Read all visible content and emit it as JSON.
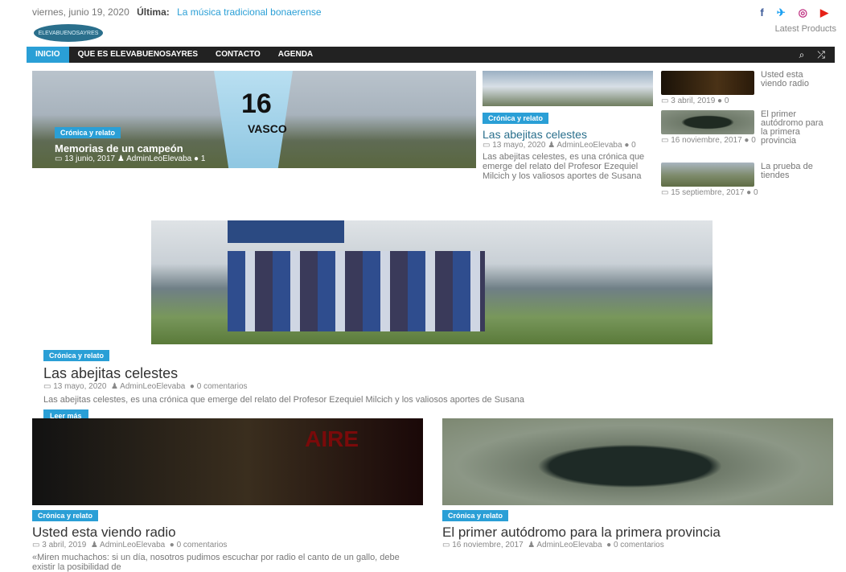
{
  "topbar": {
    "date": "viernes, junio 19, 2020",
    "ultima_label": "Última:",
    "ultima_text": "La música tradicional bonaerense",
    "latest_products": "Latest Products"
  },
  "nav": {
    "items": [
      "INICIO",
      "QUE ES ELEVABUENOSAYRES",
      "CONTACTO",
      "AGENDA"
    ],
    "search_icon": "search-icon",
    "random_icon": "shuffle-icon"
  },
  "lede": {
    "badge": "Crónica y relato",
    "title": "Memorias de un campeón",
    "date": "13 junio, 2017",
    "author": "AdminLeoElevaba",
    "comments": "1",
    "sign_number": "16",
    "sign_text": "VASCO"
  },
  "mid": {
    "badge": "Crónica y relato",
    "title": "Las abejitas celestes",
    "date": "13 mayo, 2020",
    "author": "AdminLeoElevaba",
    "comments": "0",
    "excerpt": "Las abejitas celestes, es una crónica que emerge del relato del Profesor Ezequiel Milcich y los valiosos aportes de Susana"
  },
  "side": [
    {
      "title": "Usted esta viendo radio",
      "date": "3 abril, 2019",
      "comments": "0"
    },
    {
      "title": "El primer autódromo para la primera provincia",
      "date": "16 noviembre, 2017",
      "comments": "0"
    },
    {
      "title": "La prueba de tiendes",
      "date": "15 septiembre, 2017",
      "comments": "0"
    }
  ],
  "big": {
    "badge": "Crónica y relato",
    "title": "Las abejitas celestes",
    "date": "13 mayo, 2020",
    "author": "AdminLeoElevaba",
    "comments": "0 comentarios",
    "excerpt": "Las abejitas celestes, es una crónica que emerge del relato del Profesor Ezequiel Milcich y los valiosos aportes de Susana",
    "read_more": "Leer más"
  },
  "cards": [
    {
      "badge": "Crónica y relato",
      "title": "Usted esta viendo radio",
      "date": "3 abril, 2019",
      "author": "AdminLeoElevaba",
      "comments": "0 comentarios",
      "excerpt": "«Miren muchachos: si un día, nosotros pudimos escuchar por radio el canto de un gallo, debe existir la posibilidad de",
      "img_text": "AIRE"
    },
    {
      "badge": "Crónica y relato",
      "title": "El primer autódromo para la primera provincia",
      "date": "16 noviembre, 2017",
      "author": "AdminLeoElevaba",
      "comments": "0 comentarios",
      "excerpt": ""
    }
  ],
  "colors": {
    "accent": "#2a9fd6",
    "nav_bg": "#222222"
  }
}
